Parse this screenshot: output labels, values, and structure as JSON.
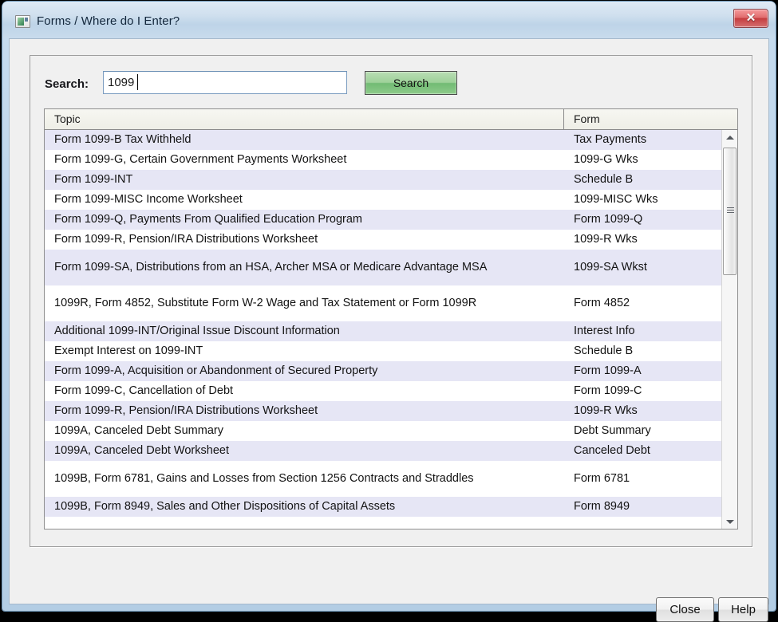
{
  "window": {
    "title": "Forms / Where do I Enter?",
    "icon": "window-app-icon",
    "close_icon": "✕"
  },
  "search": {
    "label": "Search:",
    "value": "1099",
    "placeholder": "",
    "button_label": "Search",
    "button_color": "#8ecb8a"
  },
  "table": {
    "columns": [
      "Topic",
      "Form"
    ],
    "rows": [
      {
        "topic": "Form 1099-B Tax Withheld",
        "form": "Tax Payments",
        "lines": 1
      },
      {
        "topic": "Form 1099-G, Certain Government Payments Worksheet",
        "form": "1099-G Wks",
        "lines": 1
      },
      {
        "topic": "Form 1099-INT",
        "form": "Schedule B",
        "lines": 1
      },
      {
        "topic": "Form 1099-MISC Income Worksheet",
        "form": "1099-MISC Wks",
        "lines": 1
      },
      {
        "topic": "Form 1099-Q, Payments From Qualified Education Program",
        "form": "Form 1099-Q",
        "lines": 1
      },
      {
        "topic": "Form 1099-R, Pension/IRA Distributions Worksheet",
        "form": "1099-R Wks",
        "lines": 1
      },
      {
        "topic": "Form 1099-SA, Distributions from an HSA, Archer MSA or Medicare Advantage MSA",
        "form": "1099-SA Wkst",
        "lines": 2
      },
      {
        "topic": "1099R, Form 4852, Substitute Form W-2 Wage and Tax Statement or Form 1099R",
        "form": "Form 4852",
        "lines": 2
      },
      {
        "topic": "Additional 1099-INT/Original Issue Discount Information",
        "form": "Interest Info",
        "lines": 1
      },
      {
        "topic": "Exempt Interest on 1099-INT",
        "form": "Schedule B",
        "lines": 1
      },
      {
        "topic": "Form 1099-A, Acquisition or Abandonment of Secured Property",
        "form": "Form 1099-A",
        "lines": 1
      },
      {
        "topic": "Form 1099-C, Cancellation of Debt",
        "form": "Form 1099-C",
        "lines": 1
      },
      {
        "topic": "Form 1099-R, Pension/IRA Distributions Worksheet",
        "form": "1099-R Wks",
        "lines": 1
      },
      {
        "topic": "1099A, Canceled Debt Summary",
        "form": "Debt Summary",
        "lines": 1
      },
      {
        "topic": "1099A, Canceled Debt Worksheet",
        "form": "Canceled Debt",
        "lines": 1
      },
      {
        "topic": "1099B, Form 6781, Gains and Losses from Section 1256 Contracts and Straddles",
        "form": "Form 6781",
        "lines": 2
      },
      {
        "topic": "1099B, Form 8949, Sales and Other Dispositions of Capital Assets",
        "form": "Form 8949",
        "lines": 1
      }
    ],
    "row_alt_color": "#e6e6f5",
    "row_color": "#ffffff"
  },
  "scrollbar": {
    "up_icon": "▲",
    "down_icon": "▼"
  },
  "footer": {
    "close_label": "Close",
    "help_label": "Help"
  }
}
